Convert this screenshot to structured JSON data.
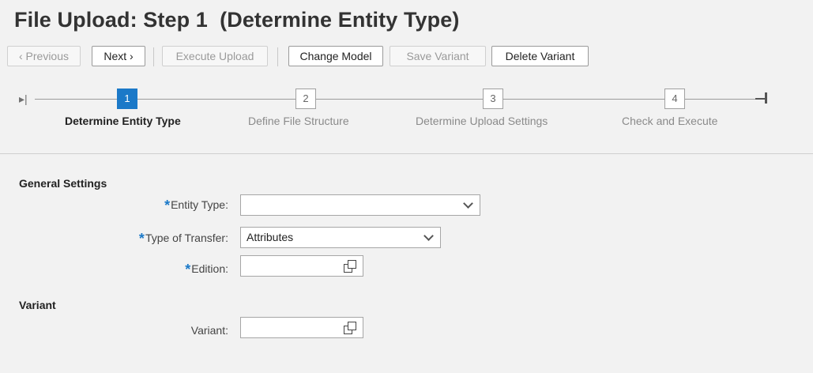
{
  "title": "File Upload: Step 1  (Determine Entity Type)",
  "toolbar": {
    "previous": "‹ Previous",
    "next": "Next ›",
    "execute_upload": "Execute Upload",
    "change_model": "Change Model",
    "save_variant": "Save Variant",
    "delete_variant": "Delete Variant"
  },
  "roadmap": {
    "steps": [
      {
        "number": "1",
        "label": "Determine Entity Type",
        "active": true
      },
      {
        "number": "2",
        "label": "Define File Structure",
        "active": false
      },
      {
        "number": "3",
        "label": "Determine Upload Settings",
        "active": false
      },
      {
        "number": "4",
        "label": "Check and Execute",
        "active": false
      }
    ]
  },
  "general_settings": {
    "title": "General Settings",
    "entity_type": {
      "label": "Entity Type:",
      "value": ""
    },
    "type_of_transfer": {
      "label": "Type of Transfer:",
      "value": "Attributes"
    },
    "edition": {
      "label": "Edition:",
      "value": ""
    }
  },
  "variant_section": {
    "title": "Variant",
    "variant": {
      "label": "Variant:",
      "value": ""
    }
  },
  "colors": {
    "accent": "#1b79c8",
    "background": "#f2f2f2"
  },
  "icons": [
    "roadmap-start-icon",
    "roadmap-end-icon",
    "dropdown-chevron-icon",
    "value-help-icon"
  ]
}
